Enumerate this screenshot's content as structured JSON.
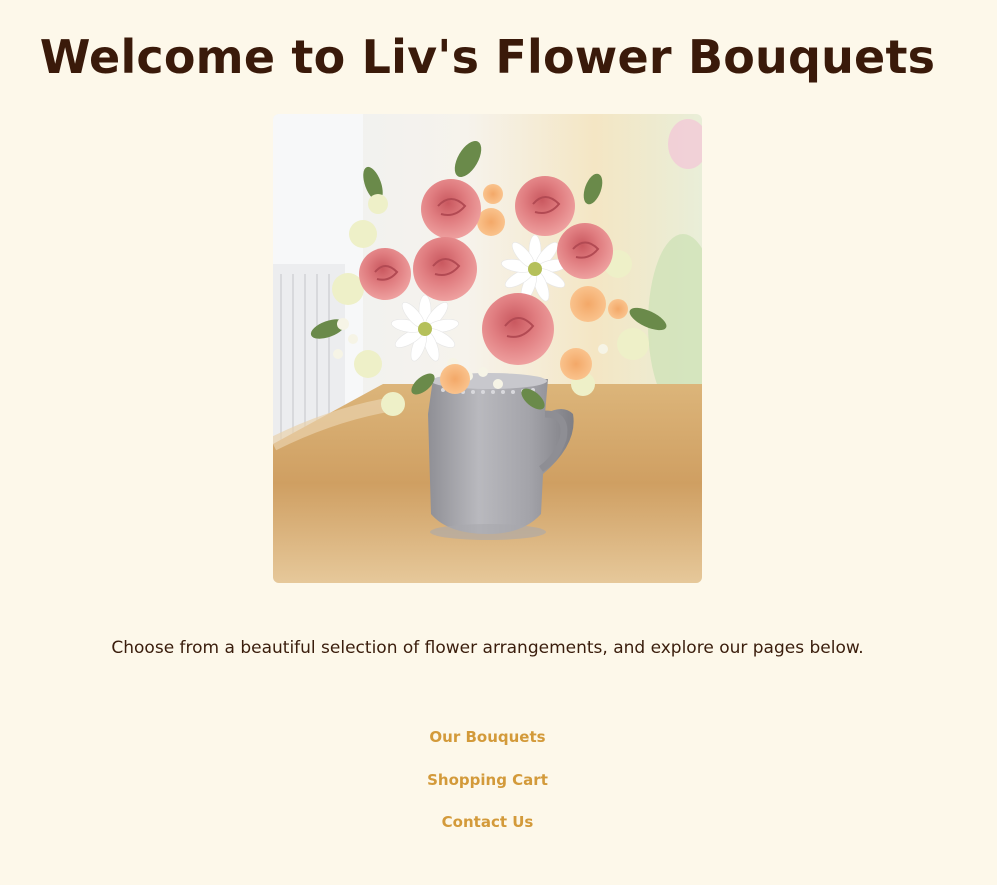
{
  "page": {
    "title": "Welcome to Liv's Flower Bouquets",
    "tagline": "Choose from a beautiful selection of flower arrangements, and explore our pages below."
  },
  "hero": {
    "icon": "flower-bouquet-in-gray-pitcher"
  },
  "nav": {
    "items": [
      {
        "label": "Our Bouquets"
      },
      {
        "label": "Shopping Cart"
      },
      {
        "label": "Contact Us"
      }
    ]
  },
  "colors": {
    "background": "#fdf8ea",
    "heading": "#3a1a0a",
    "text": "#3a1d0c",
    "link": "#d39a3a"
  }
}
